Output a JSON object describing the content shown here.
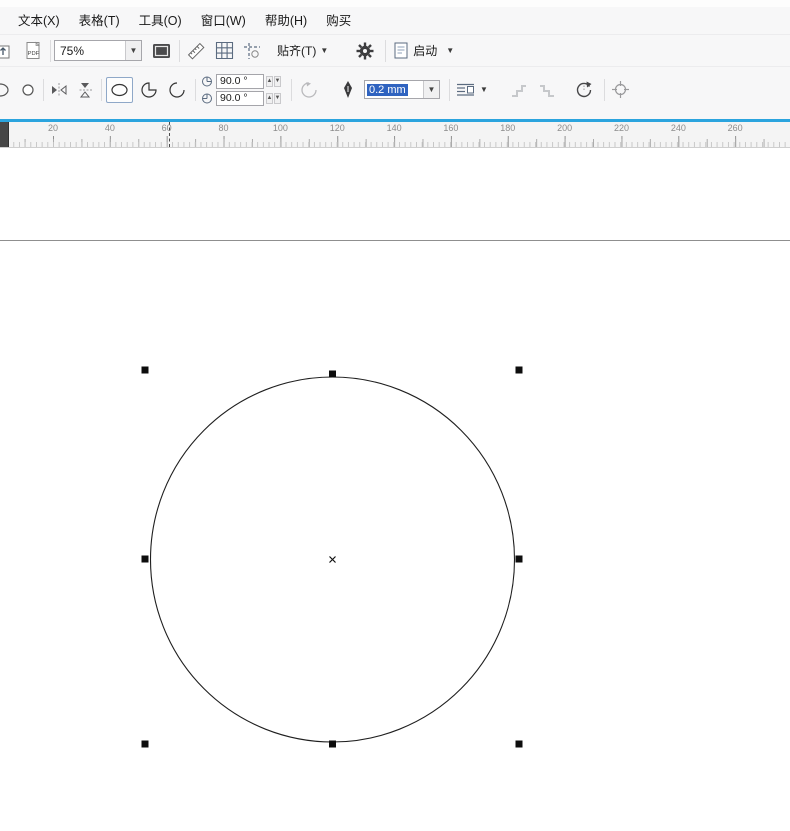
{
  "menu": {
    "items": [
      {
        "label": "文本(X)"
      },
      {
        "label": "表格(T)"
      },
      {
        "label": "工具(O)"
      },
      {
        "label": "窗口(W)"
      },
      {
        "label": "帮助(H)"
      },
      {
        "label": "购买"
      }
    ]
  },
  "standard_toolbar": {
    "pdf_label": "PDF",
    "zoom_value": "75%",
    "snap_label": "贴齐(T)",
    "launch_label": "启动"
  },
  "property_bar": {
    "start_angle": "90.0 °",
    "end_angle": "90.0 °",
    "outline_width": "0.2 mm"
  },
  "ruler": {
    "ticks": [
      "20",
      "40",
      "60",
      "80",
      "100",
      "120",
      "140",
      "160",
      "180",
      "200",
      "220",
      "240",
      "260"
    ]
  },
  "colors": {
    "accent_blue": "#2ba4de",
    "selection_blue": "#2f63c0"
  }
}
